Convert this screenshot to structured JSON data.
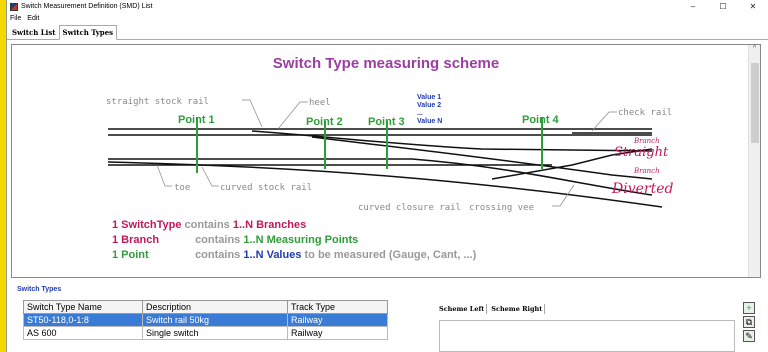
{
  "window": {
    "title": "Switch Measurement Definition (SMD) List",
    "controls": [
      "–",
      "☐",
      "✕"
    ]
  },
  "menu": [
    "File",
    "Edit"
  ],
  "tabs": [
    {
      "label": "Switch List",
      "active": false
    },
    {
      "label": "Switch Types",
      "active": true
    }
  ],
  "scheme": {
    "title": "Switch Type measuring scheme",
    "labels": {
      "straight_stock_rail": "straight stock rail",
      "heel": "heel",
      "check_rail": "check rail",
      "toe": "toe",
      "curved_stock_rail": "curved stock rail",
      "curved_closure_rail": "curved closure rail",
      "crossing_vee": "crossing vee"
    },
    "points": [
      "Point 1",
      "Point 2",
      "Point 3",
      "Point 4"
    ],
    "values": [
      "Value 1",
      "Value 2",
      "...",
      "Value N"
    ],
    "branch_straight_small": "Branch",
    "branch_straight": "Straight",
    "branch_diverted_small": "Branch",
    "branch_diverted": "Diverted",
    "legend": {
      "line1": {
        "a": "1 SwitchType",
        "b": "contains",
        "c": "1..N Branches"
      },
      "line2": {
        "a": "1 Branch",
        "b": "contains",
        "c": "1..N Measuring Points"
      },
      "line3": {
        "a": "1 Point",
        "b": "contains",
        "c": "1..N Values",
        "d": "to be measured (Gauge, Cant, ...)"
      }
    },
    "colors": {
      "title": "#9b3ea3",
      "point": "#2e9d3a",
      "value": "#1f3bb3",
      "branch": "#c2185b"
    }
  },
  "switch_types": {
    "group_title": "Switch Types",
    "columns": [
      "Switch Type Name",
      "Description",
      "Track Type"
    ],
    "rows": [
      {
        "name": "ST50-118,0-1:8",
        "description": "Switch rail 50kg",
        "track": "Railway",
        "selected": true
      },
      {
        "name": "AS 600",
        "description": "Single switch",
        "track": "Railway",
        "selected": false
      }
    ]
  },
  "scheme_tabs": [
    "Scheme Left",
    "Scheme Right"
  ],
  "tool_icons": [
    "add-icon",
    "copy-icon",
    "edit-icon"
  ]
}
